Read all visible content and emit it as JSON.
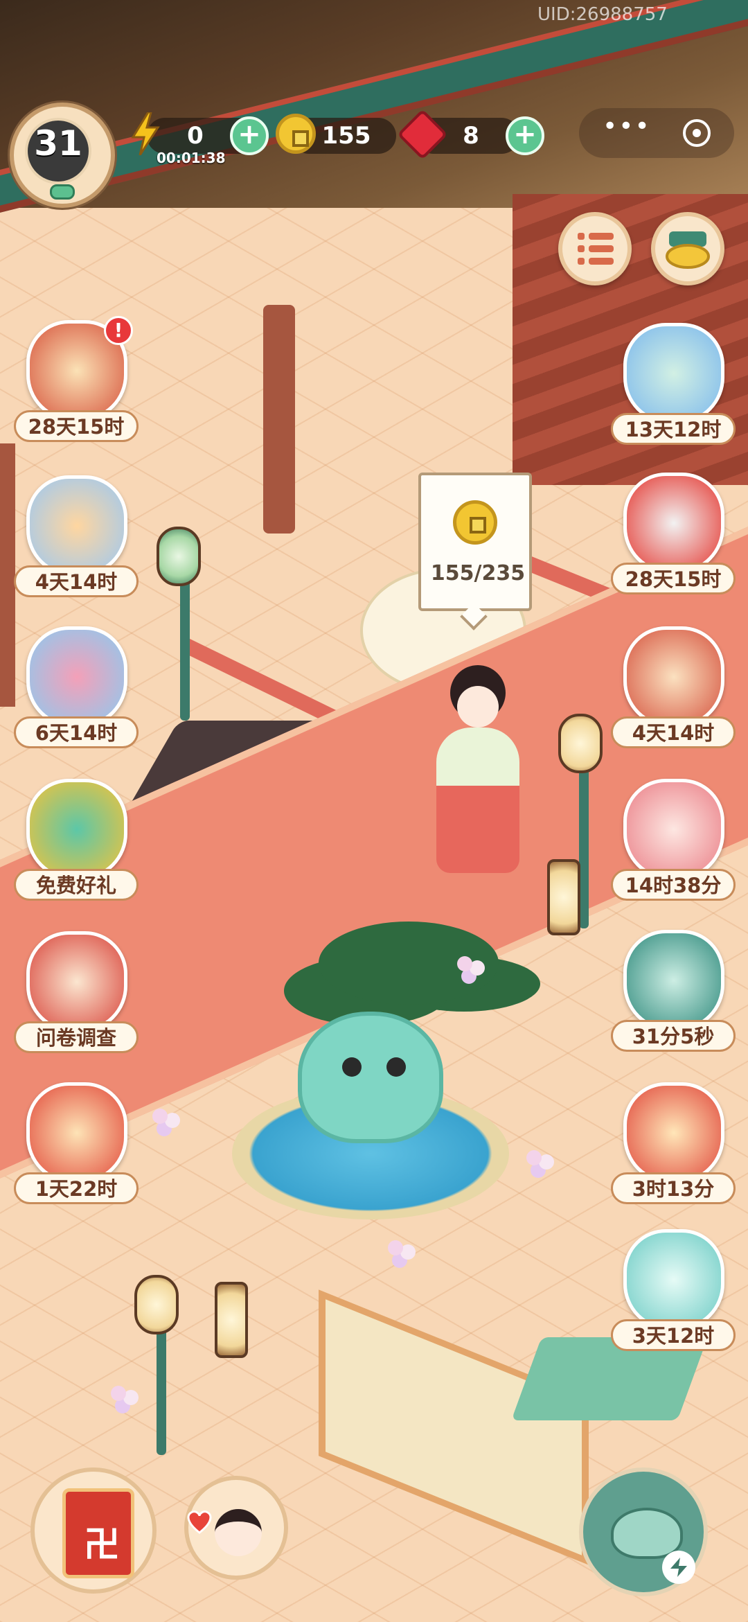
{
  "hud": {
    "uid": "UID:26988757",
    "level": "31",
    "energy": "0",
    "energy_timer": "00:01:38",
    "coins": "155",
    "gems": "8",
    "plus_symbol": "+"
  },
  "capsule": {
    "more_symbol": "•••"
  },
  "tooltip": {
    "progress": "155/235"
  },
  "left_events": [
    {
      "label": "28天15时",
      "icon": "festival-gift-icon",
      "alert": "!"
    },
    {
      "label": "4天14时",
      "icon": "fox-pet-icon"
    },
    {
      "label": "6天14时",
      "icon": "flower-fan-icon"
    },
    {
      "label": "免费好礼",
      "icon": "free-gift-icon"
    },
    {
      "label": "问卷调查",
      "icon": "survey-scroll-icon"
    },
    {
      "label": "1天22时",
      "icon": "lucky-cat-icon"
    }
  ],
  "right_events": [
    {
      "label": "13天12时",
      "icon": "cloud-cat-icon"
    },
    {
      "label": "28天15时",
      "icon": "moon-scroll-icon"
    },
    {
      "label": "4天14时",
      "icon": "fan-cat-icon"
    },
    {
      "label": "14时38分",
      "icon": "pink-cat-icon"
    },
    {
      "label": "31分5秒",
      "icon": "treasure-cat-icon"
    },
    {
      "label": "3时13分",
      "icon": "treasure-chest-icon"
    },
    {
      "label": "3天12时",
      "icon": "gift-box-cat-icon"
    }
  ],
  "bottom": {
    "book_rune": "卍"
  },
  "colors": {
    "accent_green": "#5bc590",
    "label_brown": "#6b3a24",
    "alert_red": "#e8383a"
  }
}
